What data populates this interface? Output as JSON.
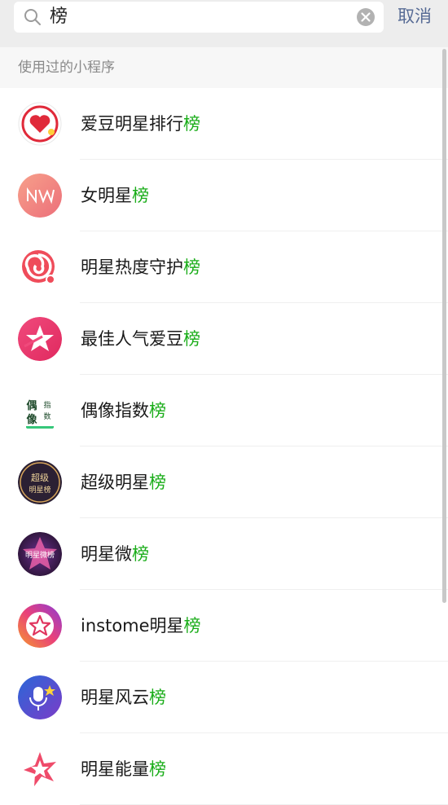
{
  "search": {
    "query": "榜",
    "cancel_label": "取消"
  },
  "section": {
    "title": "使用过的小程序"
  },
  "results": [
    {
      "prefix": "爱豆明星排行",
      "highlight": "榜",
      "icon": "heart-icon"
    },
    {
      "prefix": "女明星",
      "highlight": "榜",
      "icon": "nv-logo-icon"
    },
    {
      "prefix": "明星热度守护",
      "highlight": "榜",
      "icon": "swirl-icon"
    },
    {
      "prefix": "最佳人气爱豆",
      "highlight": "榜",
      "icon": "star-icon"
    },
    {
      "prefix": "偶像指数",
      "highlight": "榜",
      "icon": "ouxiang-logo-icon"
    },
    {
      "prefix": "超级明星",
      "highlight": "榜",
      "icon": "chaoji-logo-icon"
    },
    {
      "prefix": "明星微",
      "highlight": "榜",
      "icon": "mingxingwei-logo-icon"
    },
    {
      "prefix": "instome明星",
      "highlight": "榜",
      "icon": "star-outline-icon"
    },
    {
      "prefix": "明星风云",
      "highlight": "榜",
      "icon": "microphone-star-icon"
    },
    {
      "prefix": "明星能量",
      "highlight": "榜",
      "icon": "flower-star-icon"
    }
  ],
  "icon_text": {
    "ouxiang": [
      "偶",
      "像",
      "指",
      "数"
    ],
    "chaoji": [
      "超级",
      "明星榜"
    ],
    "mingxingwei": "明星微榜"
  },
  "colors": {
    "highlight": "#1aad19",
    "cancel": "#576b95"
  }
}
